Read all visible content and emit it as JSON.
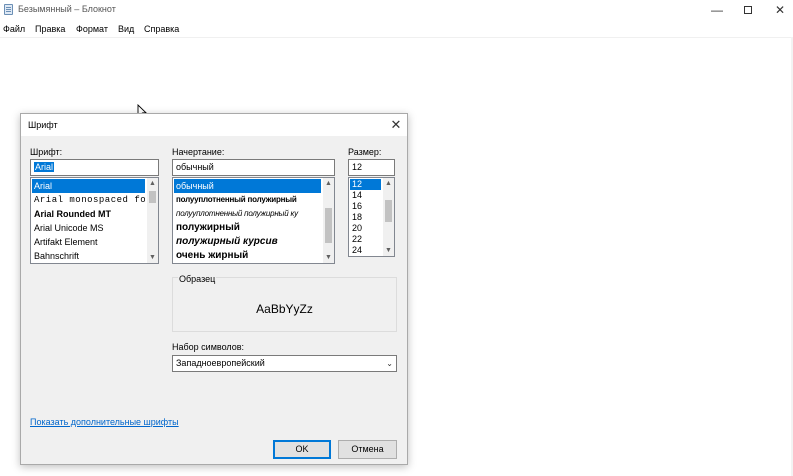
{
  "window": {
    "title": "Безымянный – Блокнот",
    "controls": {
      "minimize": "—",
      "close": "✕"
    }
  },
  "menubar": {
    "items": [
      "Файл",
      "Правка",
      "Формат",
      "Вид",
      "Справка"
    ]
  },
  "dialog": {
    "title": "Шрифт",
    "close": "✕",
    "font": {
      "label": "Шрифт:",
      "value": "Arial",
      "items": [
        "Arial",
        "Arial monospaced fo",
        "Arial Rounded MT",
        "Arial Unicode MS",
        "Artifakt Element",
        "Bahnschrift"
      ],
      "selected_index": 0
    },
    "style": {
      "label": "Начертание:",
      "value": "обычный",
      "items": [
        "обычный",
        "полууплотненный полужирный",
        "полууплотненный полужирный ку",
        "полужирный",
        "полужирный курсив",
        "очень жирный"
      ],
      "selected_index": 0
    },
    "size": {
      "label": "Размер:",
      "value": "12",
      "items": [
        "12",
        "14",
        "16",
        "18",
        "20",
        "22",
        "24"
      ],
      "selected_index": 0
    },
    "sample": {
      "label": "Образец",
      "text": "AaBbYyZz"
    },
    "charset": {
      "label": "Набор символов:",
      "value": "Западноевропейский"
    },
    "more_fonts_link": "Показать дополнительные шрифты",
    "ok_label": "OK",
    "cancel_label": "Отмена",
    "scroll_up": "▲",
    "scroll_down": "▼",
    "dropdown_arrow": "⌄"
  },
  "colors": {
    "selection": "#0078d7",
    "link": "#0066cc",
    "dialog_bg": "#f0f0f0"
  }
}
